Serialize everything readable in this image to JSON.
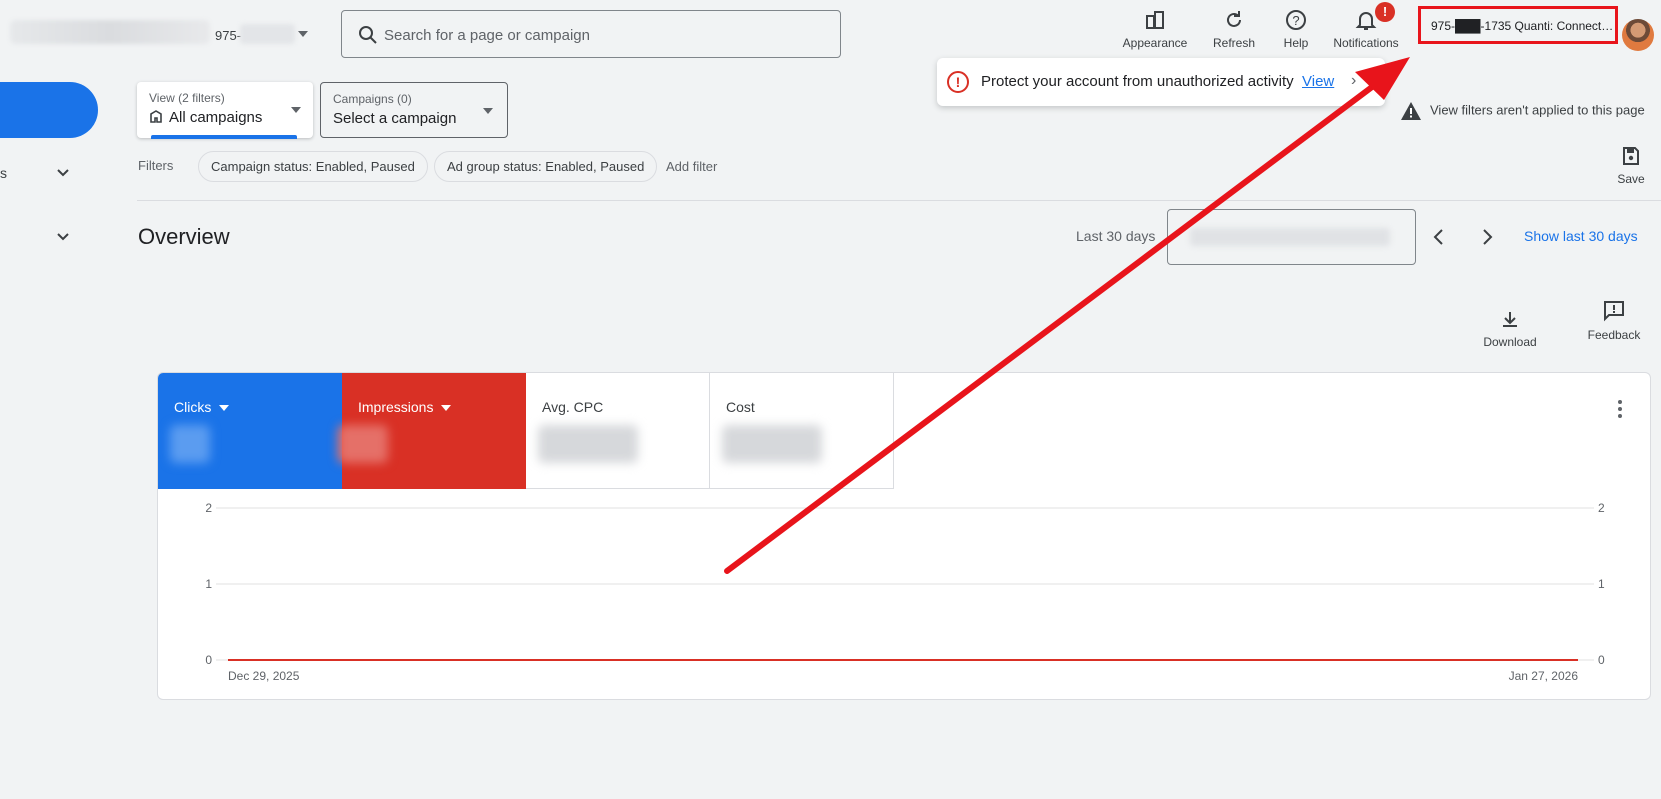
{
  "header": {
    "account_number": "975-",
    "search_placeholder": "Search for a page or campaign",
    "buttons": {
      "appearance": "Appearance",
      "refresh": "Refresh",
      "help": "Help",
      "notifications": "Notifications"
    },
    "notifications_badge": "!",
    "account_chip": "975-███-1735 Quanti: Connect…"
  },
  "toast": {
    "icon": "!",
    "message": "Protect your account from unauthorized activity",
    "link": "View",
    "chevron": "›"
  },
  "warning": {
    "text": "View filters aren't applied to this page",
    "icon": "warning-icon"
  },
  "sidebar": {
    "partial_label": "s"
  },
  "filters": {
    "view_small": "View (2 filters)",
    "view_big": "All campaigns",
    "campaigns_small": "Campaigns (0)",
    "campaigns_big": "Select a campaign",
    "label": "Filters",
    "chips": [
      "Campaign status: Enabled, Paused",
      "Ad group status: Enabled, Paused"
    ],
    "add_filter": "Add filter",
    "save": "Save"
  },
  "overview": {
    "title": "Overview",
    "range_label": "Last 30 days",
    "show_last": "Show last 30 days",
    "download": "Download",
    "feedback": "Feedback"
  },
  "metrics": [
    {
      "label": "Clicks",
      "dropdown": true,
      "color": "#1a73e8"
    },
    {
      "label": "Impressions",
      "dropdown": true,
      "color": "#d93025"
    },
    {
      "label": "Avg. CPC",
      "dropdown": false
    },
    {
      "label": "Cost",
      "dropdown": false
    }
  ],
  "chart_data": {
    "type": "line",
    "x": [
      "Dec 29, 2025",
      "Jan 27, 2026"
    ],
    "x_tick_labels": [
      "Dec 29, 2025",
      "Jan 27, 2026"
    ],
    "y_ticks_left": [
      0,
      1,
      2
    ],
    "y_ticks_right": [
      0,
      1,
      2
    ],
    "ylim": [
      0,
      2
    ],
    "series": [
      {
        "name": "Clicks",
        "color": "#1a73e8",
        "values": [
          0,
          0
        ]
      },
      {
        "name": "Impressions",
        "color": "#d93025",
        "values": [
          0,
          0
        ]
      }
    ],
    "grid": true
  },
  "colors": {
    "accent": "#1a73e8",
    "error": "#d93025",
    "annotation": "#e8141b"
  }
}
